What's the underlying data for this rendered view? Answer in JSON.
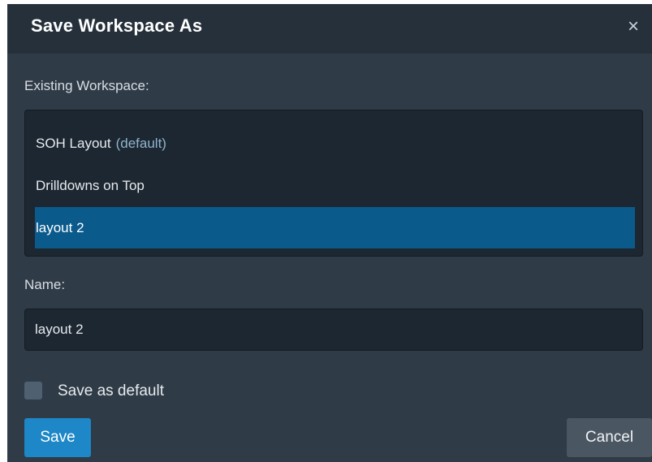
{
  "dialog": {
    "title": "Save Workspace As",
    "close_label": "×"
  },
  "existing": {
    "label": "Existing Workspace:",
    "items": [
      {
        "name": "SOH Layout",
        "suffix": "(default)",
        "selected": false
      },
      {
        "name": "Drilldowns on Top",
        "suffix": "",
        "selected": false
      },
      {
        "name": "layout 2",
        "suffix": "",
        "selected": true
      }
    ]
  },
  "name": {
    "label": "Name:",
    "value": "layout 2"
  },
  "default_checkbox": {
    "label": "Save as default",
    "checked": false
  },
  "buttons": {
    "save_label": "Save",
    "cancel_label": "Cancel"
  },
  "colors": {
    "background": "#2f3b47",
    "titlebar": "#25303b",
    "selection": "#0a5a8c",
    "primary_button": "#1d87c7"
  }
}
